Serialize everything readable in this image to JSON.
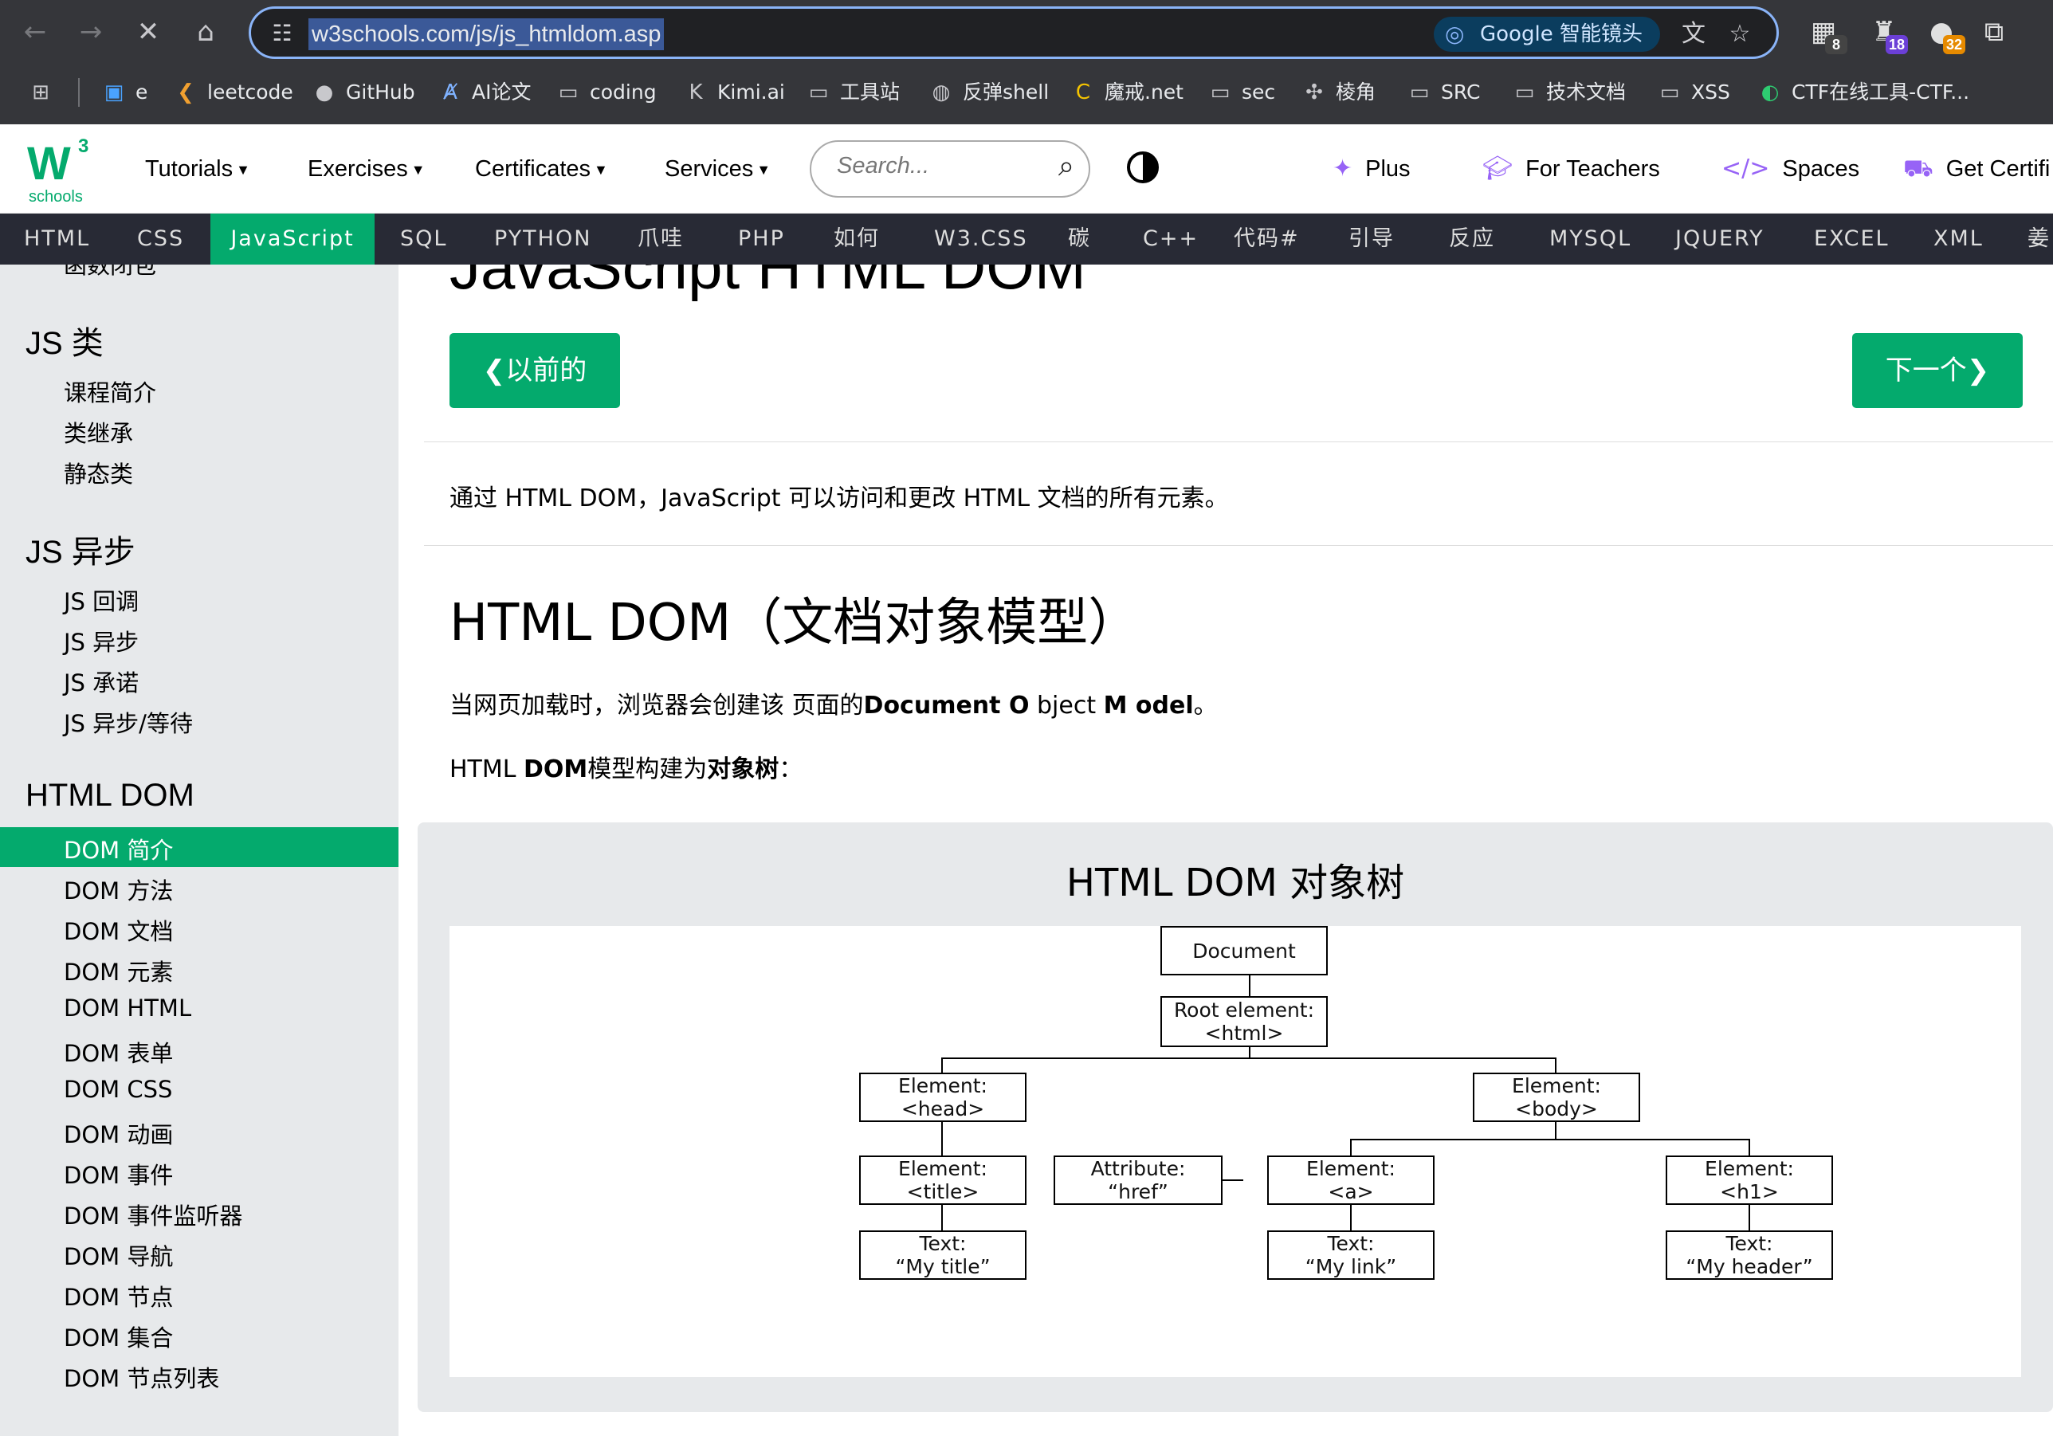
{
  "browser": {
    "url": "w3schools.com/js/js_htmldom.asp",
    "lens_label": "Google 智能镜头",
    "extension_badges": [
      "8",
      "18",
      "32"
    ],
    "bookmarks": [
      "e",
      "leetcode",
      "GitHub",
      "AI论文",
      "coding",
      "Kimi.ai",
      "工具站",
      "反弹shell",
      "魔戒.net",
      "sec",
      "棱角",
      "SRC",
      "技术文档",
      "XSS",
      "CTF在线工具-CTF..."
    ]
  },
  "site": {
    "logo_three": "3",
    "logo_schools": "schools",
    "menu": [
      "Tutorials",
      "Exercises",
      "Certificates",
      "Services"
    ],
    "search_placeholder": "Search...",
    "right_menu": [
      "Plus",
      "For Teachers",
      "Spaces",
      "Get Certifi"
    ],
    "languages": [
      "HTML",
      "CSS",
      "JavaScript",
      "SQL",
      "PYTHON",
      "爪哇",
      "PHP",
      "如何",
      "W3.CSS",
      "碳",
      "C++",
      "代码#",
      "引导",
      "反应",
      "MYSQL",
      "JQUERY",
      "EXCEL",
      "XML",
      "姜"
    ],
    "active_language": "JavaScript"
  },
  "sidebar": {
    "cut_item": "函数闭包",
    "sections": [
      {
        "heading": "JS 类",
        "items": [
          "课程简介",
          "类继承",
          "静态类"
        ]
      },
      {
        "heading": "JS 异步",
        "items": [
          "JS 回调",
          "JS 异步",
          "JS 承诺",
          "JS 异步/等待"
        ]
      },
      {
        "heading": "HTML DOM",
        "items": [
          "DOM 简介",
          "DOM 方法",
          "DOM 文档",
          "DOM 元素",
          "DOM HTML",
          "DOM 表单",
          "DOM CSS",
          "DOM 动画",
          "DOM 事件",
          "DOM 事件监听器",
          "DOM 导航",
          "DOM 节点",
          "DOM 集合",
          "DOM 节点列表"
        ]
      }
    ],
    "active_item": "DOM 简介"
  },
  "main": {
    "page_title": "JavaScript HTML DOM",
    "prev_label": "❮以前的",
    "next_label": "下一个❯",
    "intro": "通过 HTML DOM，JavaScript 可以访问和更改 HTML 文档的所有元素。",
    "h2": "HTML DOM（文档对象模型）",
    "p1": {
      "pre": "当网页加载时，浏览器会创建该 页面的",
      "b1": "Document O",
      "mid": " bject ",
      "b2": "M odel",
      "post": "。"
    },
    "p2": {
      "pre": "HTML ",
      "b1": "DOM",
      "mid": "模型构建为",
      "b2": "对象树",
      "post": "："
    },
    "diagram_title": "HTML DOM 对象树",
    "tree": {
      "document": "Document",
      "root": [
        "Root element:",
        "<html>"
      ],
      "head": [
        "Element:",
        "<head>"
      ],
      "body": [
        "Element:",
        "<body>"
      ],
      "title": [
        "Element:",
        "<title>"
      ],
      "attr": [
        "Attribute:",
        "“href”"
      ],
      "a": [
        "Element:",
        "<a>"
      ],
      "h1": [
        "Element:",
        "<h1>"
      ],
      "text_title": [
        "Text:",
        "“My title”"
      ],
      "text_link": [
        "Text:",
        "“My link”"
      ],
      "text_header": [
        "Text:",
        "“My header”"
      ]
    }
  }
}
